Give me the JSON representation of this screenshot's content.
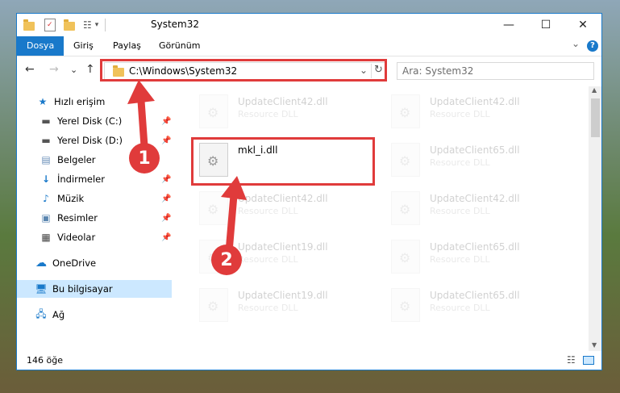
{
  "window": {
    "title": "System32",
    "minimize_icon": "—",
    "maximize_icon": "☐",
    "close_icon": "✕"
  },
  "ribbon": {
    "tabs": [
      "Dosya",
      "Giriş",
      "Paylaş",
      "Görünüm"
    ],
    "expand_icon": "⌄",
    "help_icon": "?"
  },
  "nav": {
    "back": "←",
    "forward": "→",
    "recent": "⌄",
    "up": "↑",
    "address": "C:\\Windows\\System32",
    "dropdown": "⌄",
    "refresh": "↻",
    "search_placeholder": "Ara: System32"
  },
  "sidebar": {
    "quick_access": "Hızlı erişim",
    "items": [
      "Yerel Disk (C:)",
      "Yerel Disk (D:)",
      "Belgeler",
      "İndirmeler",
      "Müzik",
      "Resimler",
      "Videolar"
    ],
    "onedrive": "OneDrive",
    "this_pc": "Bu bilgisayar",
    "network": "Ağ"
  },
  "files": {
    "col1": [
      {
        "name": "UpdateClient42.dll",
        "desc": "Resource DLL"
      },
      {
        "name": "mkl_i.dll",
        "desc": ""
      },
      {
        "name": "UpdateClient42.dll",
        "desc": "Resource DLL"
      },
      {
        "name": "UpdateClient19.dll",
        "desc": "Resource DLL"
      },
      {
        "name": "UpdateClient19.dll",
        "desc": "Resource DLL"
      }
    ],
    "col2": [
      {
        "name": "UpdateClient42.dll",
        "desc": "Resource DLL"
      },
      {
        "name": "UpdateClient65.dll",
        "desc": "Resource DLL"
      },
      {
        "name": "UpdateClient42.dll",
        "desc": "Resource DLL"
      },
      {
        "name": "UpdateClient65.dll",
        "desc": "Resource DLL"
      },
      {
        "name": "UpdateClient65.dll",
        "desc": "Resource DLL"
      }
    ]
  },
  "status": {
    "count": "146 öğe"
  },
  "annotations": {
    "step1": "1",
    "step2": "2",
    "color": "#e03b3b"
  },
  "colors": {
    "accent": "#1979ca",
    "selection": "#cce8ff"
  }
}
